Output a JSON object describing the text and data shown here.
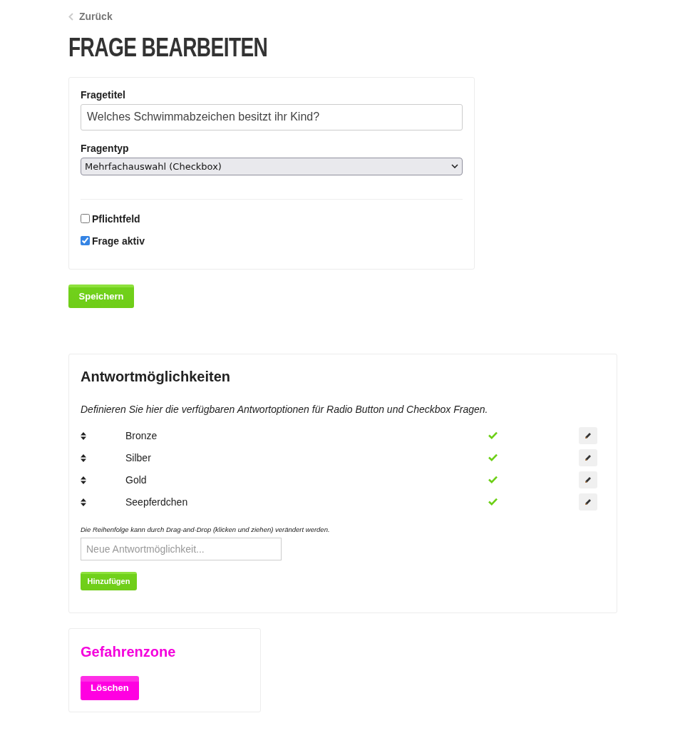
{
  "back_link": {
    "label": "Zurück"
  },
  "page_title": "FRAGE BEARBEITEN",
  "question_form": {
    "fields": [
      {
        "kind": "text",
        "label": "Fragetitel",
        "value": "Welches Schwimmabzeichen besitzt ihr Kind?"
      },
      {
        "kind": "select",
        "label": "Fragentyp",
        "value": "Mehrfachauswahl (Checkbox)"
      }
    ],
    "options": [
      {
        "label": "Pflichtfeld",
        "checked": false
      },
      {
        "label": "Frage aktiv",
        "checked": true
      }
    ]
  },
  "save_button": "Speichern",
  "answers": {
    "title": "Antwortmöglichkeiten",
    "description": "Definieren Sie hier die verfügbaren Antwortoptionen für Radio Button und Checkbox Fragen.",
    "items": [
      {
        "label": "Bronze",
        "active": true
      },
      {
        "label": "Silber",
        "active": true
      },
      {
        "label": "Gold",
        "active": true
      },
      {
        "label": "Seepferdchen",
        "active": true
      }
    ],
    "hint": "Die Reihenfolge kann durch Drag-and-Drop (klicken und ziehen) verändert werden.",
    "new_answer": {
      "placeholder": "Neue Antwortmöglichkeit..."
    },
    "add_button": "Hinzufügen"
  },
  "danger_zone": {
    "title": "Gefahrenzone",
    "delete_button": "Löschen"
  }
}
